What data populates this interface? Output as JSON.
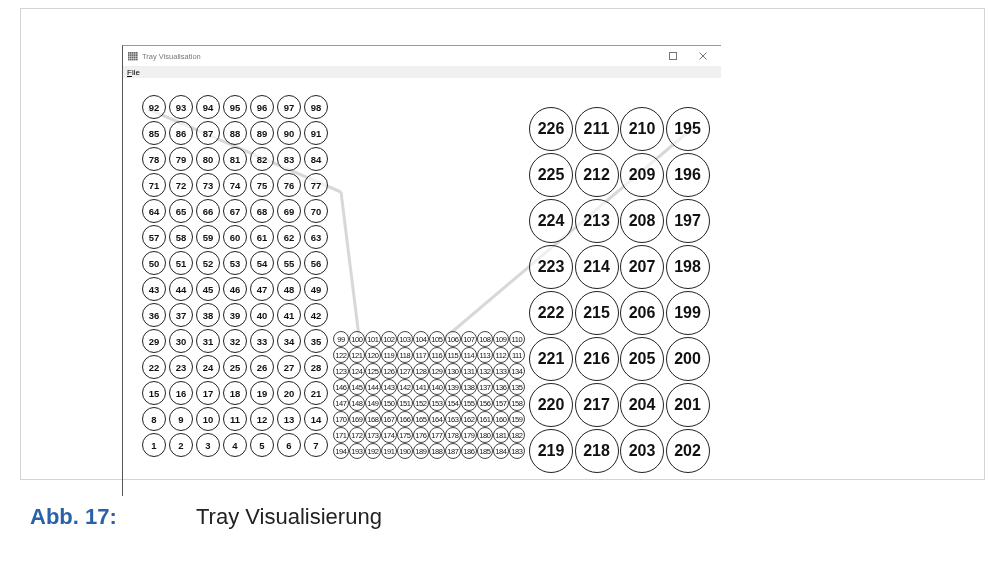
{
  "window": {
    "title": "Tray Visualisation"
  },
  "menu": [
    {
      "label": "File"
    }
  ],
  "trays": [
    {
      "kind": "large",
      "rows": [
        [
          "92",
          "93",
          "94",
          "95",
          "96",
          "97",
          "98"
        ],
        [
          "85",
          "86",
          "87",
          "88",
          "89",
          "90",
          "91"
        ],
        [
          "78",
          "79",
          "80",
          "81",
          "82",
          "83",
          "84"
        ],
        [
          "71",
          "72",
          "73",
          "74",
          "75",
          "76",
          "77"
        ],
        [
          "64",
          "65",
          "66",
          "67",
          "68",
          "69",
          "70"
        ],
        [
          "57",
          "58",
          "59",
          "60",
          "61",
          "62",
          "63"
        ],
        [
          "50",
          "51",
          "52",
          "53",
          "54",
          "55",
          "56"
        ],
        [
          "43",
          "44",
          "45",
          "46",
          "47",
          "48",
          "49"
        ],
        [
          "36",
          "37",
          "38",
          "39",
          "40",
          "41",
          "42"
        ],
        [
          "29",
          "30",
          "31",
          "32",
          "33",
          "34",
          "35"
        ],
        [
          "22",
          "23",
          "24",
          "25",
          "26",
          "27",
          "28"
        ],
        [
          "15",
          "16",
          "17",
          "18",
          "19",
          "20",
          "21"
        ],
        [
          "8",
          "9",
          "10",
          "11",
          "12",
          "13",
          "14"
        ],
        [
          "1",
          "2",
          "3",
          "4",
          "5",
          "6",
          "7"
        ]
      ]
    },
    {
      "kind": "small",
      "rows": [
        [
          "99",
          "100",
          "101",
          "102",
          "103",
          "104",
          "105",
          "106",
          "107",
          "108",
          "109",
          "110"
        ],
        [
          "122",
          "121",
          "120",
          "119",
          "118",
          "117",
          "116",
          "115",
          "114",
          "113",
          "112",
          "111"
        ],
        [
          "123",
          "124",
          "125",
          "126",
          "127",
          "128",
          "129",
          "130",
          "131",
          "132",
          "133",
          "134"
        ],
        [
          "146",
          "145",
          "144",
          "143",
          "142",
          "141",
          "140",
          "139",
          "138",
          "137",
          "136",
          "135"
        ],
        [
          "147",
          "148",
          "149",
          "150",
          "151",
          "152",
          "153",
          "154",
          "155",
          "156",
          "157",
          "158"
        ],
        [
          "170",
          "169",
          "168",
          "167",
          "166",
          "165",
          "164",
          "163",
          "162",
          "161",
          "160",
          "159"
        ],
        [
          "171",
          "172",
          "173",
          "174",
          "175",
          "176",
          "177",
          "178",
          "179",
          "180",
          "181",
          "182"
        ],
        [
          "194",
          "193",
          "192",
          "191",
          "190",
          "189",
          "188",
          "187",
          "186",
          "185",
          "184",
          "183"
        ]
      ]
    },
    {
      "kind": "xlarge",
      "rows": [
        [
          "226",
          "211",
          "210",
          "195"
        ],
        [
          "225",
          "212",
          "209",
          "196"
        ],
        [
          "224",
          "213",
          "208",
          "197"
        ],
        [
          "223",
          "214",
          "207",
          "198"
        ],
        [
          "222",
          "215",
          "206",
          "199"
        ],
        [
          "221",
          "216",
          "205",
          "200"
        ],
        [
          "220",
          "217",
          "204",
          "201"
        ],
        [
          "219",
          "218",
          "203",
          "202"
        ]
      ]
    }
  ],
  "caption": {
    "number": "Abb. 17:",
    "text": "Tray Visualisierung"
  }
}
